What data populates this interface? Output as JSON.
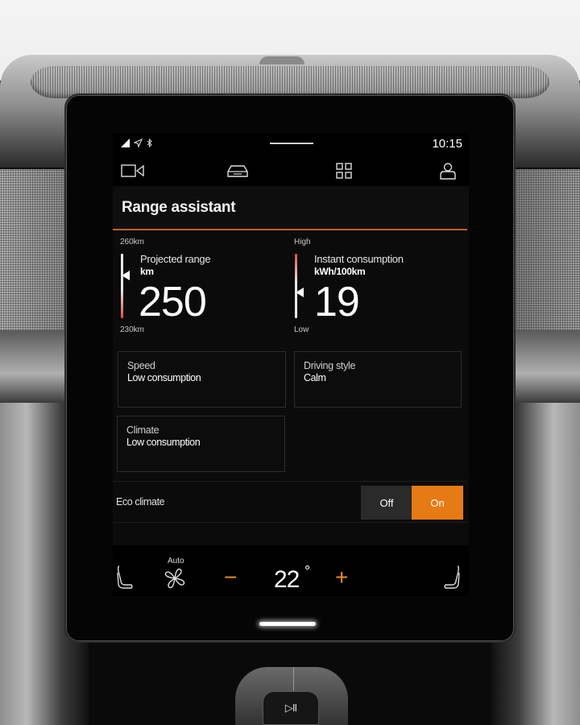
{
  "status_bar": {
    "time": "10:15",
    "icons": [
      "signal-icon",
      "location-arrow-icon",
      "bluetooth-icon"
    ]
  },
  "nav_bar": {
    "items": [
      {
        "icon": "camera-icon",
        "label": "Camera"
      },
      {
        "icon": "car-icon",
        "label": "Car"
      },
      {
        "icon": "apps-grid-icon",
        "label": "Apps"
      },
      {
        "icon": "profile-icon",
        "label": "Profile"
      }
    ]
  },
  "page": {
    "title": "Range assistant"
  },
  "gauges": {
    "range": {
      "top_label": "260km",
      "bottom_label": "230km",
      "label": "Projected range",
      "unit": "km",
      "value": "250",
      "min": 230,
      "max": 260,
      "current": 250
    },
    "consumption": {
      "top_label": "High",
      "bottom_label": "Low",
      "label": "Instant consumption",
      "unit": "kWh/100km",
      "value": "19",
      "level_fraction": 0.4
    }
  },
  "cards": [
    {
      "title": "Speed",
      "value": "Low consumption"
    },
    {
      "title": "Driving style",
      "value": "Calm"
    },
    {
      "title": "Climate",
      "value": "Low consumption"
    }
  ],
  "eco_climate": {
    "label": "Eco climate",
    "options": [
      "Off",
      "On"
    ],
    "selected": "On"
  },
  "climate_bar": {
    "fan_mode": "Auto",
    "temperature": "22",
    "degree_symbol": "°",
    "decrease_symbol": "−",
    "increase_symbol": "+"
  },
  "console": {
    "media_button": "▷II"
  },
  "colors": {
    "accent": "#e67a14",
    "accent_line": "#b8642a",
    "gauge_red": "#e04a4a"
  }
}
